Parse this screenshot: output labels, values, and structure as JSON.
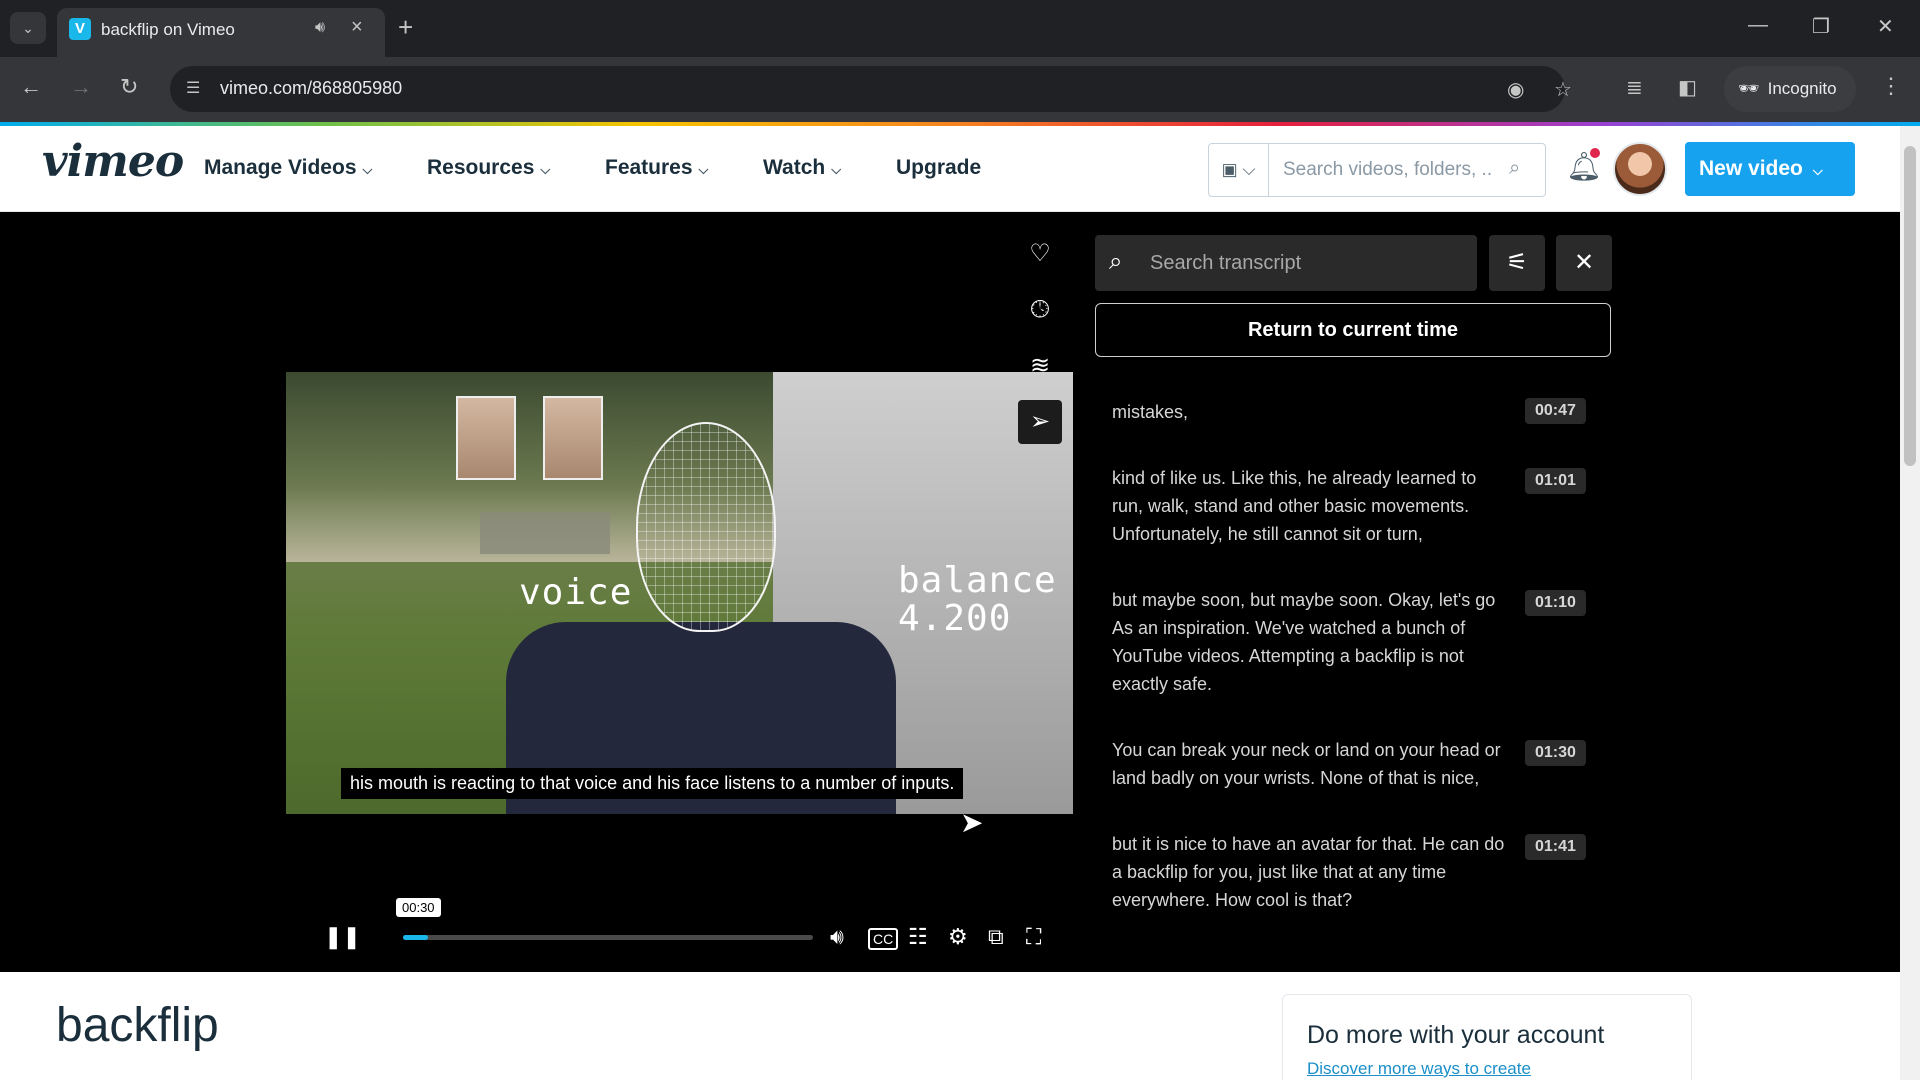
{
  "browser": {
    "tab_title": "backflip on Vimeo",
    "tab_favicon": "V",
    "url": "vimeo.com/868805980",
    "profile_label": "Incognito"
  },
  "header": {
    "logo": "vimeo",
    "nav": [
      "Manage Videos",
      "Resources",
      "Features",
      "Watch",
      "Upgrade"
    ],
    "search_placeholder": "Search videos, folders, ...",
    "new_video_label": "New video"
  },
  "player": {
    "overlay_words": [
      "voice",
      "balance",
      "4.200"
    ],
    "caption": "his mouth is reacting to that voice and his face listens to a number of inputs.",
    "current_time": "00:30",
    "progress": 0.06
  },
  "transcript": {
    "search_placeholder": "Search transcript",
    "return_label": "Return to current time",
    "items": [
      {
        "text": "mistakes,",
        "time": "00:47"
      },
      {
        "text": "kind of like us. Like this, he already learned to run, walk, stand and other basic movements. Unfortunately, he still cannot sit or turn,",
        "time": "01:01"
      },
      {
        "text": "but maybe soon, but maybe soon. Okay, let's go As an inspiration. We've watched a bunch of YouTube videos. Attempting a backflip is not exactly safe.",
        "time": "01:10"
      },
      {
        "text": "You can break your neck or land on your head or land badly on your wrists. None of that is nice,",
        "time": "01:30"
      },
      {
        "text": "but it is nice to have an avatar for that. He can do a backflip for you, just like that at any time everywhere. How cool is that?",
        "time": "01:41"
      }
    ]
  },
  "page": {
    "video_title": "backflip",
    "account_card_title": "Do more with your account",
    "account_card_link": "Discover more ways to create"
  },
  "colors": {
    "brand": "#1ab7ea",
    "new_video_button": "#17a2f0",
    "notification_dot": "#e0264c"
  }
}
